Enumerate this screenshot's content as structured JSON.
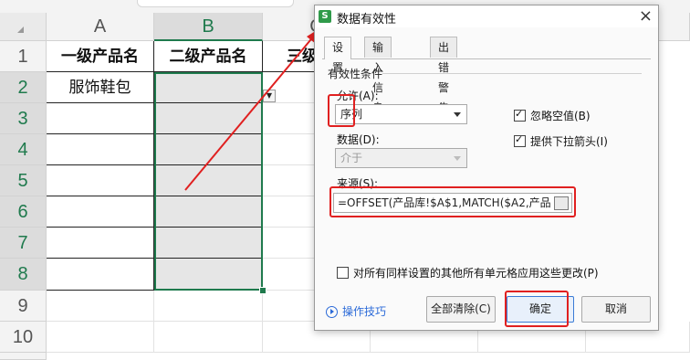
{
  "sheet": {
    "columns": [
      "A",
      "B",
      "C"
    ],
    "rows": [
      "1",
      "2",
      "3",
      "4",
      "5",
      "6",
      "7",
      "8",
      "9",
      "10"
    ],
    "header_a": "一级产品名",
    "header_b": "二级产品名",
    "header_c_partial": "三级",
    "cell_a2": "服饰鞋包",
    "selected_column": "B",
    "accent_color": "#1f7a4d"
  },
  "dialog": {
    "app_icon": "S",
    "title": "数据有效性",
    "close": "×",
    "tabs": [
      "设置",
      "输入信息",
      "出错警告"
    ],
    "active_tab": "设置",
    "group_label": "有效性条件",
    "allow_label": "允许(A):",
    "allow_value": "序列",
    "data_label": "数据(D):",
    "data_value": "介于",
    "ignore_blank_label": "忽略空值(B)",
    "ignore_blank_checked": true,
    "dropdown_arrow_label": "提供下拉箭头(I)",
    "dropdown_arrow_checked": true,
    "source_label": "来源(S):",
    "source_value": "=OFFSET(产品库!$A$1,MATCH($A2,产品",
    "apply_all_label": "对所有同样设置的其他所有单元格应用这些更改(P)",
    "apply_all_checked": false,
    "tips_link": "操作技巧",
    "clear_all_button": "全部清除(C)",
    "ok_button": "确定",
    "cancel_button": "取消",
    "highlight_color": "#e02020"
  }
}
